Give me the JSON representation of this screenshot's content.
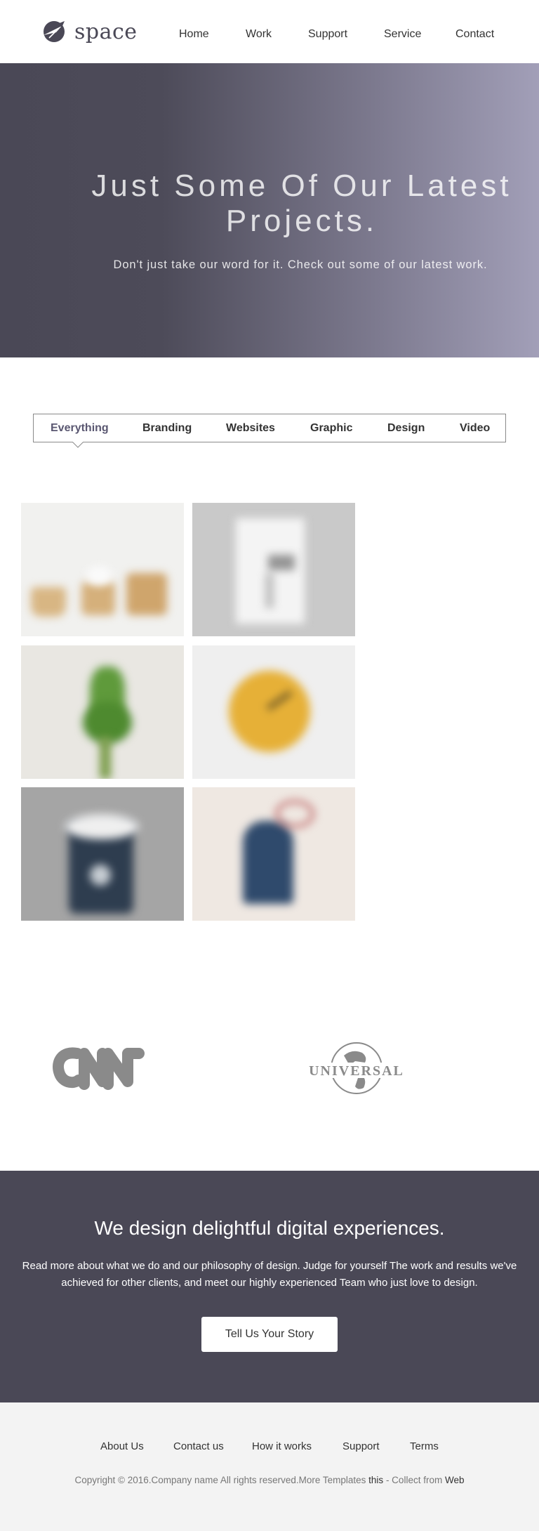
{
  "header": {
    "logo_text": "space",
    "nav": [
      "Home",
      "Work",
      "Support",
      "Service",
      "Contact"
    ]
  },
  "hero": {
    "title_line1": "Just Some Of Our Latest",
    "title_line2": "Projects.",
    "subtitle": "Don't just take our word for it. Check out some of our latest work."
  },
  "filters": {
    "items": [
      "Everything",
      "Branding",
      "Websites",
      "Graphic",
      "Design",
      "Video"
    ],
    "active": "Everything"
  },
  "portfolio": {
    "items": [
      "paper-cups",
      "poster-mockup",
      "plant",
      "yellow-clock",
      "coffee-cup",
      "blue-tag"
    ]
  },
  "clients": {
    "logos": [
      "cnn-logo",
      "universal-logo"
    ],
    "universal_text": "UNIVERSAL"
  },
  "cta": {
    "title": "We design delightful digital experiences.",
    "text": "Read more about what we do and our philosophy of design. Judge for yourself The work and results we've achieved for other clients, and meet our highly experienced Team who just love to design.",
    "button": "Tell Us Your Story"
  },
  "footer": {
    "links": [
      "About Us",
      "Contact us",
      "How it works",
      "Support",
      "Terms"
    ],
    "copyright": "Copyright © 2016.Company name All rights reserved.More Templates ",
    "link_this": "this",
    "collect": " - Collect from ",
    "link_web": "Web"
  },
  "colors": {
    "dark": "#4a4856",
    "accent": "#5a5771",
    "footer_bg": "#f3f3f3"
  }
}
